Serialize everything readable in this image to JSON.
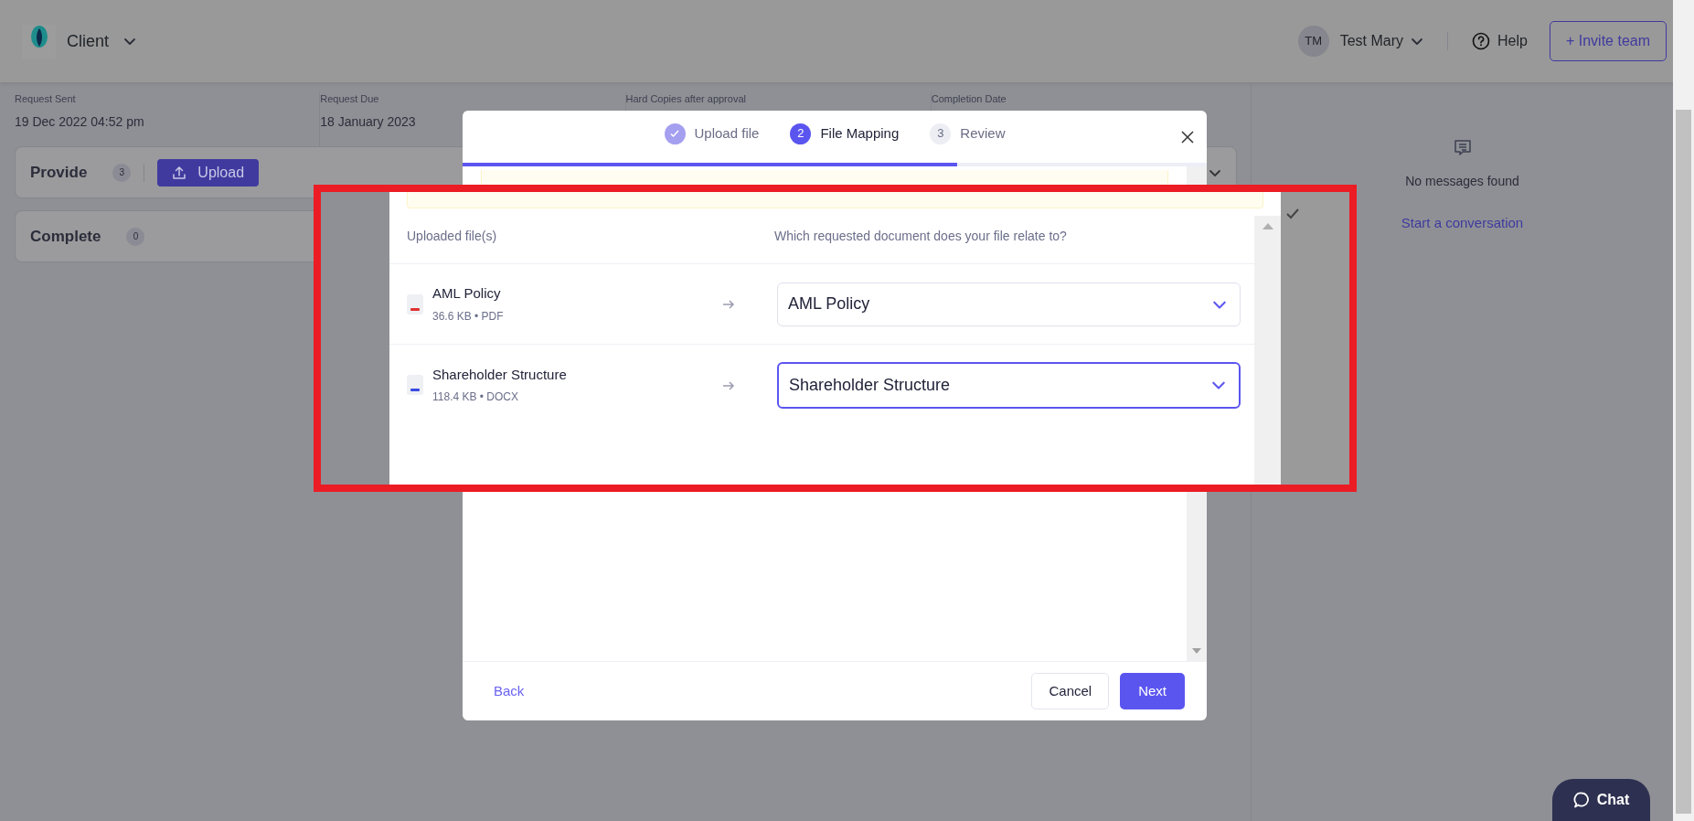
{
  "header": {
    "app_switcher": "Client",
    "user": {
      "initials": "TM",
      "name": "Test Mary"
    },
    "help": "Help",
    "invite_button": "+ Invite team"
  },
  "request_info": [
    {
      "label": "Request Sent",
      "value": "19 Dec 2022 04:52 pm"
    },
    {
      "label": "Request Due",
      "value": "18 January 2023"
    },
    {
      "label": "Hard Copies after approval"
    },
    {
      "label": "Completion Date"
    }
  ],
  "sections": [
    {
      "title": "Provide",
      "count": "3",
      "upload_button": "Upload"
    },
    {
      "title": "Complete",
      "count": "0"
    }
  ],
  "messages": {
    "empty_text": "No messages found",
    "link": "Start a conversation"
  },
  "modal": {
    "steps": [
      {
        "label": "Upload file",
        "kind": "done"
      },
      {
        "number": "2",
        "label": "File Mapping",
        "kind": "current"
      },
      {
        "number": "3",
        "label": "Review",
        "kind": "pending"
      }
    ],
    "progress": {
      "level": 0.665
    },
    "back": "Back",
    "cancel": "Cancel",
    "next": "Next"
  },
  "callout": {
    "columns": [
      "Uploaded file(s)",
      "Which requested document does your file relate to?"
    ],
    "rows": [
      {
        "file": "AML Policy",
        "meta": "36.6 KB • PDF",
        "kind": "pdf",
        "mapping": "AML Policy",
        "focused": false
      },
      {
        "file": "Shareholder Structure",
        "meta": "118.4 KB • DOCX",
        "kind": "doc",
        "mapping": "Shareholder Structure",
        "focused": true
      }
    ]
  },
  "chat_button": "Chat"
}
